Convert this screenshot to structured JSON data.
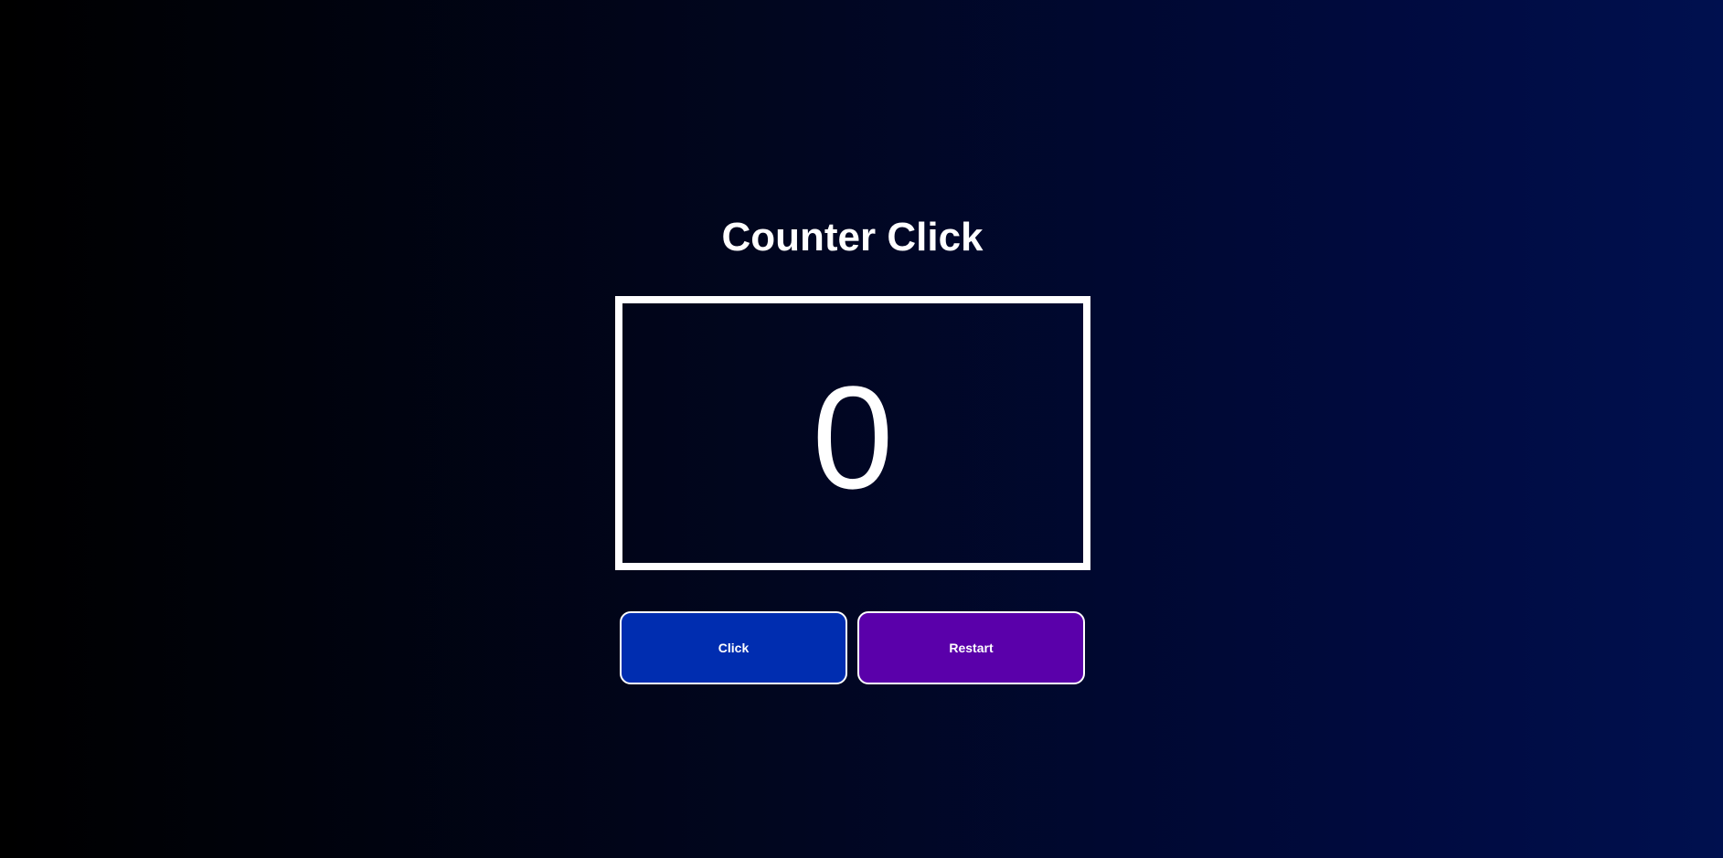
{
  "app": {
    "title": "Counter Click",
    "counter_value": "0"
  },
  "buttons": {
    "click_label": "Click",
    "restart_label": "Restart"
  },
  "colors": {
    "click_button": "#002db0",
    "restart_button": "#5a00aa",
    "background_start": "#000000",
    "background_end": "#00104f",
    "text": "#ffffff"
  }
}
